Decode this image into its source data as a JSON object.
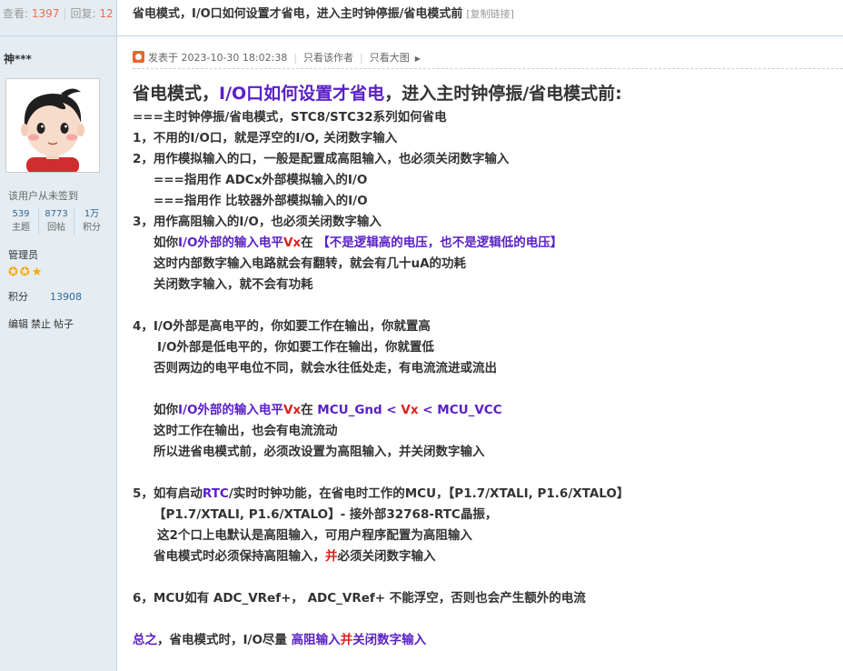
{
  "topstats": {
    "views_label": "查看:",
    "views": "1397",
    "replies_label": "回复:",
    "replies": "12"
  },
  "thread_title": "省电模式，I/O口如何设置才省电，进入主时钟停振/省电模式前",
  "copy_link": "[复制链接]",
  "user": {
    "name": "神***",
    "signin": "该用户从未签到",
    "stats": [
      {
        "value": "539",
        "label": "主题"
      },
      {
        "value": "8773",
        "label": "回帖"
      },
      {
        "value": "1万",
        "label": "积分"
      }
    ],
    "role": "管理员",
    "stars": "✪✪★",
    "points_label": "积分",
    "points": "13908",
    "actions": [
      "编辑",
      "禁止",
      "帖子"
    ]
  },
  "post": {
    "posted_at": "发表于 2023-10-30 18:02:38",
    "only_author": "只看该作者",
    "only_image": "只看大图"
  },
  "content": {
    "h1a": "省电模式，",
    "h1b": "I/O口如何设置才省电",
    "h1c": "，进入主时钟停振/省电模式前:",
    "l1": "===主时钟停振/省电模式，STC8/STC32系列如何省电",
    "l2": "1，不用的I/O口，就是浮空的I/O, 关闭数字输入",
    "l3": "2，用作模拟输入的口，一般是配置成高阻输入，也必须关闭数字输入",
    "l4": "===指用作 ADCx外部模拟输入的I/O",
    "l5": "===指用作 比较器外部模拟输入的I/O",
    "l6": "3，用作高阻输入的I/O，也必须关闭数字输入",
    "l7a": "如你",
    "l7b": "I/O外部的输入电平",
    "l7c": "Vx",
    "l7d": "在 ",
    "l7e": "【不是逻辑高的电压，也不是逻辑低的电压】",
    "l8": "这时内部数字输入电路就会有翻转，就会有几十uA的功耗",
    "l9": "关闭数字输入，就不会有功耗",
    "l10": "4，I/O外部是高电平的，你如要工作在输出，你就置高",
    "l11": "I/O外部是低电平的，你如要工作在输出，你就置低",
    "l12": "否则两边的电平电位不同，就会水往低处走，有电流流进或流出",
    "l13a": "如你",
    "l13b": "I/O外部的输入电平",
    "l13c": "Vx",
    "l13d": "在 ",
    "l13e": "MCU_Gnd < ",
    "l13f": "Vx",
    "l13g": " < MCU_VCC",
    "l14": "这时工作在输出，也会有电流流动",
    "l15": "所以进省电模式前，必须改设置为高阻输入，并关闭数字输入",
    "l16a": "5，如有启动",
    "l16b": "RTC",
    "l16c": "/实时时钟功能，在省电时工作的MCU，【P1.7/XTALI, P1.6/XTALO】",
    "l17": "【P1.7/XTALI, P1.6/XTALO】- 接外部32768-RTC晶振，",
    "l18": "这2个口上电默认是高阻输入，可用户程序配置为高阻输入",
    "l19a": "省电模式时必须保持高阻输入，",
    "l19b": "并",
    "l19c": "必须关闭数字输入",
    "l20": "6，MCU如有 ADC_VRef+， ADC_VRef+ 不能浮空，否则也会产生额外的电流",
    "l21a": "总之",
    "l21b": "，省电模式时，I/O尽量 ",
    "l21c": "高阻输入",
    "l21d": "并",
    "l21e": "关闭数字输入"
  }
}
